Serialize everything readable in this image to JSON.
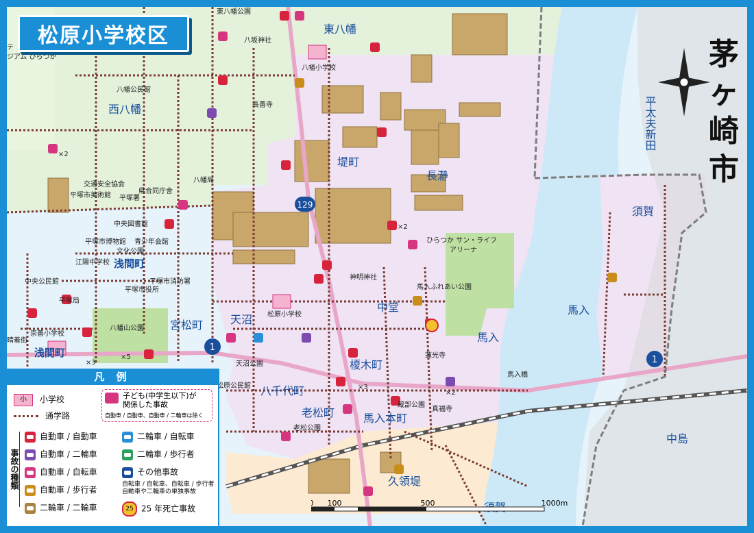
{
  "title": "松原小学校区",
  "neighbor_city": "茅ヶ崎市",
  "areas": {
    "higashi_hachiman": "東八幡",
    "nishi_hachiman": "西八幡",
    "tsutsumicho": "堤町",
    "nagashizuka": "長瀞",
    "suka": "須賀",
    "heitaifu": "平太夫新田",
    "asamacho": "浅間町",
    "asamacho2": "浅間町",
    "miyamatsucho": "宮松町",
    "amanuma": "天沼",
    "nakazato": "中堂",
    "enokicho": "榎木町",
    "hachichiyo": "八千代町",
    "oimatsucho": "老松町",
    "umairihoncho": "馬入本町",
    "umairi": "馬入",
    "umairi2": "馬入",
    "nakajima": "中島",
    "kuryodo": "久領堤",
    "suka2": "須賀"
  },
  "places": {
    "hachiman_shrine": "八坂神社",
    "higashi_hachiman_park": "東八幡公園",
    "hachiman_school": "八幡小学校",
    "hachiman_hall": "八幡公民館",
    "chozenji": "長善寺",
    "hachiman_station": "八幡局",
    "kotsu_anzen": "交通安全協会",
    "museum_art": "平塚市美術館",
    "kendo": "県合同庁舎",
    "hiratsuka_police": "平塚署",
    "central_library": "中央図書館",
    "city_museum": "平塚市博物館",
    "seishonen": "青少年会館",
    "bunka_park": "文化公園",
    "koyo_jhs": "江陽中学校",
    "central_kominkan": "中央公民館",
    "city_hall": "平塚市役所",
    "fire_dept": "平塚市消防署",
    "hiratsuka_po": "平塚局",
    "hachimanyama_park": "八幡山公園",
    "sosen_school": "崇善小学校",
    "matsubara_school": "松原小学校",
    "shinmei_shrine": "神明神社",
    "umairi_fureai": "馬入ふれあい公園",
    "arena": "ひらつか サン・ライフ\nアリーナ",
    "renkoji": "蓮光寺",
    "matsubara_kominkan": "松原公民館",
    "oimatsu_park": "老松公園",
    "kurabe_park": "蔵部公園",
    "shinpukuji": "真福寺",
    "amanuma_park": "天沼公園",
    "bridge": "馬入橋",
    "teiji": "テ\nジアム ひらつか",
    "haretugai": "晴着街"
  },
  "routes": {
    "r129": "129",
    "r1": "1",
    "r1b": "1",
    "r129b": "129"
  },
  "counts": {
    "x2": "×2",
    "x3": "×3",
    "x5": "×5"
  },
  "legend": {
    "header": "凡 例",
    "school_icon": "小",
    "school": "小学校",
    "route": "通学路",
    "child_title": "子ども(中学生以下)が\n関係した事故",
    "child_note": "自動車 / 自動車、自動車 / 二輪車は除く",
    "accident_type": "事故の種類",
    "items_left": [
      "自動車 / 自動車",
      "自動車 / 二輪車",
      "自動車 / 自転車",
      "自動車 / 歩行者",
      "二輪車 / 二輪車"
    ],
    "items_right": [
      "二輪車 / 自転車",
      "二輪車 / 歩行者",
      "その他事故"
    ],
    "other_note": "自転車 / 自転車、自転車 / 歩行者\n自動車や二輪車の単独事故",
    "death": "25 年死亡事故",
    "death_badge": "25"
  },
  "scale": {
    "labels": [
      "0",
      "100",
      "500",
      "1000m"
    ]
  },
  "colors": {
    "frame": "#1a8fd6",
    "river": "#cde9f7",
    "district": "#f0e4f5",
    "north": "#e4f2dc",
    "south": "#fbebd3",
    "building": "#c9a76a",
    "route_dot": "#7a3a32"
  }
}
